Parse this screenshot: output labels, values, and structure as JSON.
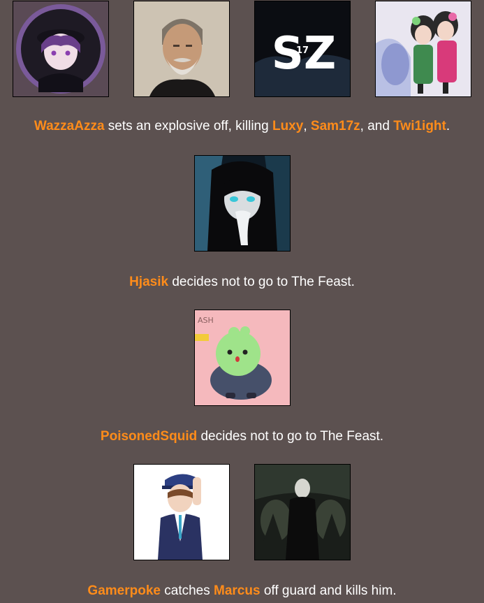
{
  "events": [
    {
      "tributes": [
        "WazzaAzza",
        "Luxy",
        "Sam17z",
        "Twi1ight"
      ],
      "sentence": {
        "n1": "WazzaAzza",
        "t1": " sets an explosive off, killing ",
        "n2": "Luxy",
        "t2": ", ",
        "n3": "Sam17z",
        "t3": ", and ",
        "n4": "Twi1ight",
        "t4": "."
      }
    },
    {
      "tributes": [
        "Hjasik"
      ],
      "sentence": {
        "n1": "Hjasik",
        "t1": " decides not to go to The Feast."
      }
    },
    {
      "tributes": [
        "PoisonedSquid"
      ],
      "sentence": {
        "n1": "PoisonedSquid",
        "t1": " decides not to go to The Feast."
      }
    },
    {
      "tributes": [
        "Gamerpoke",
        "Marcus"
      ],
      "sentence": {
        "n1": "Gamerpoke",
        "t1": " catches ",
        "n2": "Marcus",
        "t2": " off guard and kills him."
      }
    }
  ],
  "avatar_text": {
    "sam17z_logo": "SZ",
    "sam17z_small": "17",
    "squid_sign": "ASH"
  },
  "colors": {
    "background": "#5c5150",
    "name_highlight": "#ff8c1a",
    "text": "#ffffff"
  }
}
